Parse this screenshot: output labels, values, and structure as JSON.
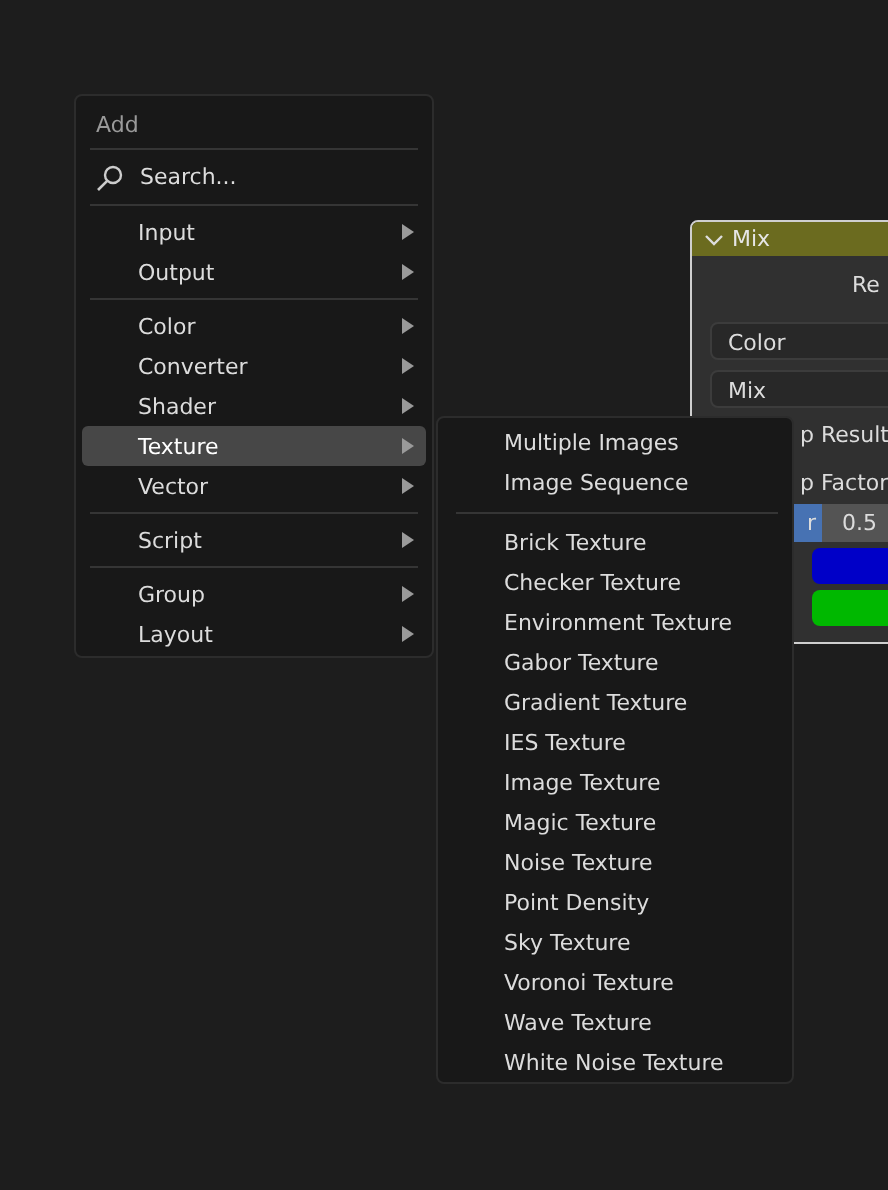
{
  "node": {
    "title": "Mix",
    "output_label": "Re",
    "data_type": "Color",
    "blend_mode": "Mix",
    "clamp_result": "p Result",
    "clamp_factor": "p Factor",
    "factor": {
      "label": "r",
      "value": "0.5",
      "level": 0.5
    },
    "swatches": [
      {
        "color": "#0000c8"
      },
      {
        "color": "#00b800"
      }
    ]
  },
  "menu": {
    "title": "Add",
    "search": {
      "placeholder": "Search..."
    },
    "groups": [
      [
        {
          "label": "Input",
          "submenu": true,
          "selected": false
        },
        {
          "label": "Output",
          "submenu": true,
          "selected": false
        }
      ],
      [
        {
          "label": "Color",
          "submenu": true,
          "selected": false
        },
        {
          "label": "Converter",
          "submenu": true,
          "selected": false
        },
        {
          "label": "Shader",
          "submenu": true,
          "selected": false
        },
        {
          "label": "Texture",
          "submenu": true,
          "selected": true
        },
        {
          "label": "Vector",
          "submenu": true,
          "selected": false
        }
      ],
      [
        {
          "label": "Script",
          "submenu": true,
          "selected": false
        }
      ],
      [
        {
          "label": "Group",
          "submenu": true,
          "selected": false
        },
        {
          "label": "Layout",
          "submenu": true,
          "selected": false
        }
      ]
    ]
  },
  "submenu": {
    "groups": [
      [
        "Multiple Images",
        "Image Sequence"
      ],
      [
        "Brick Texture",
        "Checker Texture",
        "Environment Texture",
        "Gabor Texture",
        "Gradient Texture",
        "IES Texture",
        "Image Texture",
        "Magic Texture",
        "Noise Texture",
        "Point Density",
        "Sky Texture",
        "Voronoi Texture",
        "Wave Texture",
        "White Noise Texture"
      ]
    ]
  }
}
